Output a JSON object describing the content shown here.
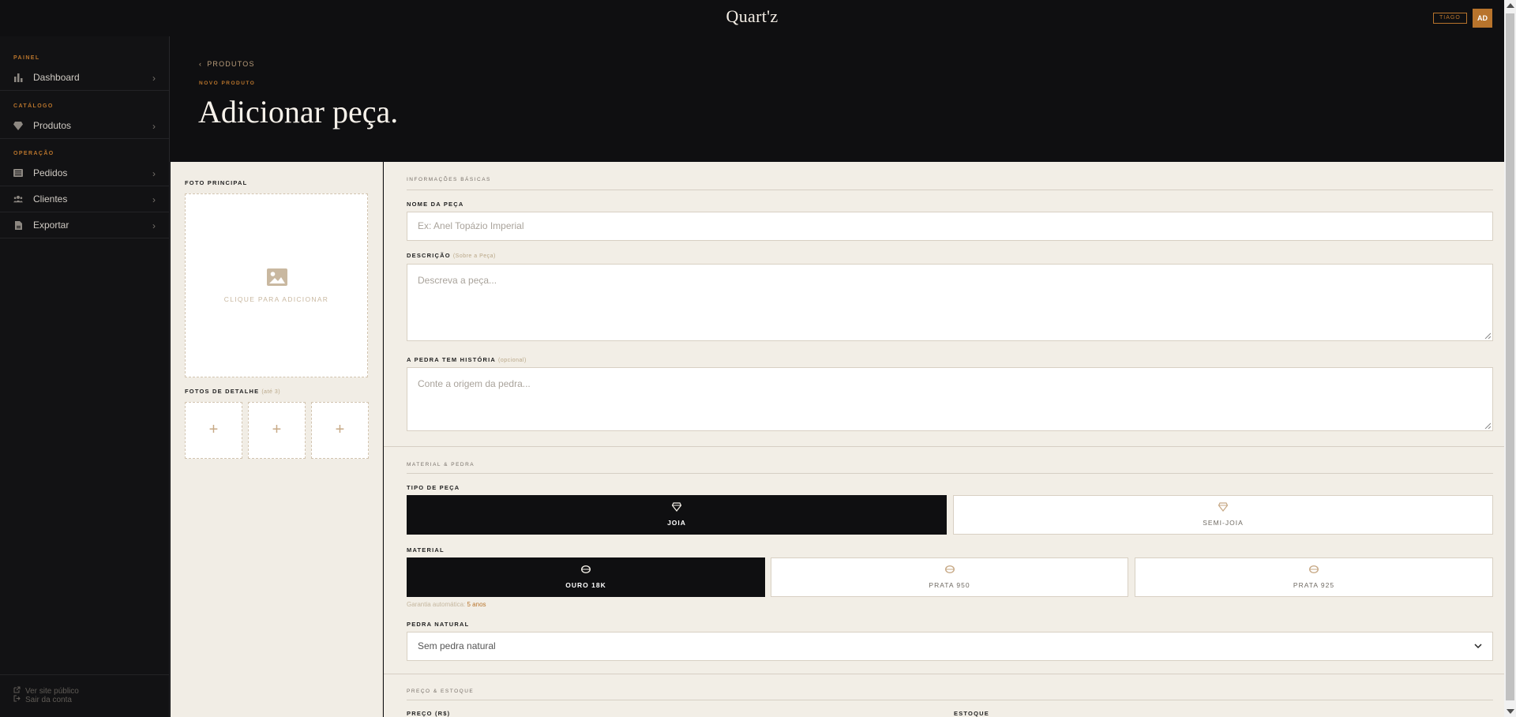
{
  "app": {
    "brand": "Quart'z",
    "user_tag": "TIAGO",
    "avatar_initials": "AD"
  },
  "sidebar": {
    "sections": [
      {
        "title": "PAINEL"
      },
      {
        "title": "CATÁLOGO"
      },
      {
        "title": "OPERAÇÃO"
      }
    ],
    "items": [
      {
        "label": "Dashboard",
        "icon": "bar-chart-icon"
      },
      {
        "label": "Produtos",
        "icon": "diamond-icon"
      },
      {
        "label": "Pedidos",
        "icon": "list-icon"
      },
      {
        "label": "Clientes",
        "icon": "users-icon"
      },
      {
        "label": "Exportar",
        "icon": "file-icon"
      }
    ],
    "footer": {
      "public_site": "Ver site público",
      "logout": "Sair da conta"
    }
  },
  "header": {
    "breadcrumb": "PRODUTOS",
    "eyebrow": "NOVO PRODUTO",
    "title": "Adicionar peça."
  },
  "photos": {
    "main_label": "FOTO PRINCIPAL",
    "main_cta": "CLIQUE PARA ADICIONAR",
    "detail_label": "FOTOS DE DETALHE",
    "detail_hint": "(até 3)",
    "slot_symbol": "+"
  },
  "form": {
    "basic_section": "INFORMAÇÕES BÁSICAS",
    "name_label": "NOME DA PEÇA",
    "name_placeholder": "Ex: Anel Topázio Imperial",
    "description_label": "DESCRIÇÃO",
    "description_hint": "(Sobre a Peça)",
    "description_placeholder": "Descreva a peça...",
    "story_label": "A PEDRA TEM HISTÓRIA",
    "story_hint": "(opcional)",
    "story_placeholder": "Conte a origem da pedra...",
    "material_section": "MATERIAL & PEDRA",
    "type_label": "TIPO DE PEÇA",
    "types": [
      {
        "label": "JOIA",
        "selected": true
      },
      {
        "label": "SEMI-JOIA",
        "selected": false
      }
    ],
    "material_label": "MATERIAL",
    "materials": [
      {
        "label": "OURO 18K",
        "selected": true
      },
      {
        "label": "PRATA 950",
        "selected": false
      },
      {
        "label": "PRATA 925",
        "selected": false
      }
    ],
    "guarantee_prefix": "Garantia automática:",
    "guarantee_value": "5 anos",
    "stone_label": "PEDRA NATURAL",
    "stone_value": "Sem pedra natural",
    "price_section": "PREÇO & ESTOQUE",
    "price_label": "PREÇO (R$)",
    "stock_label": "ESTOQUE"
  },
  "colors": {
    "accent": "#b8742c",
    "dark": "#0f0f11",
    "cream": "#f2eee6"
  }
}
